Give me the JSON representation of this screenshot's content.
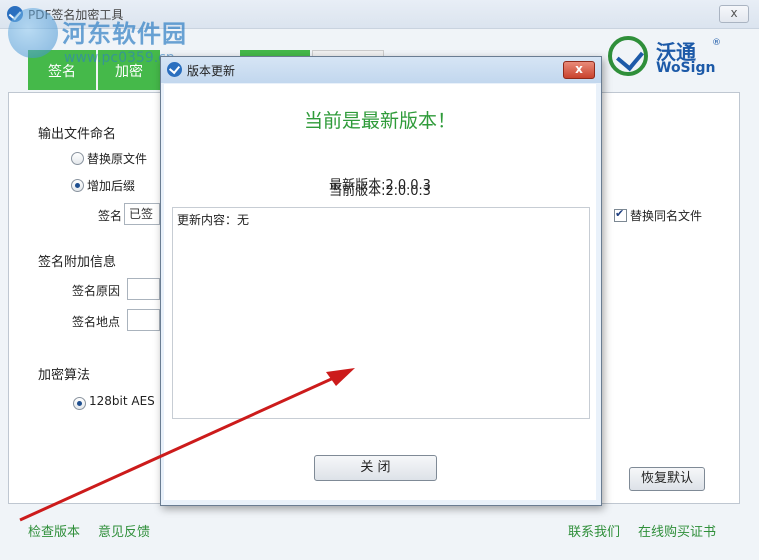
{
  "main": {
    "title": "PDF签名加密工具",
    "close_glyph": "x",
    "watermark": {
      "site": "河东软件园",
      "url": "www.pc0359.cn"
    },
    "tabs": [
      "签名",
      "加密",
      "",
      ""
    ],
    "brand": {
      "cn": "沃通",
      "en": "WoSign",
      "reg": "®"
    },
    "output_naming": {
      "heading": "输出文件命名",
      "option_replace": "替换原文件",
      "option_suffix": "增加后缀",
      "selected": "增加后缀",
      "name_label": "签名",
      "name_value": "已签名"
    },
    "replace_same_name": {
      "label": "替换同名文件",
      "checked": true
    },
    "sign_info": {
      "heading": "签名附加信息",
      "reason_label": "签名原因",
      "reason_value": "",
      "location_label": "签名地点",
      "location_value": ""
    },
    "encryption": {
      "heading": "加密算法",
      "option": "128bit AES",
      "selected": true
    },
    "restore_defaults": "恢复默认",
    "footer_links": {
      "check_version": "检查版本",
      "feedback": "意见反馈",
      "contact": "联系我们",
      "buy_cert": "在线购买证书"
    }
  },
  "dialog": {
    "title": "版本更新",
    "close_glyph": "x",
    "headline": "当前是最新版本！",
    "latest_version": "最新版本:2.0.0.3",
    "current_version": "当前版本:2.0.0.3",
    "notes": "更新内容：无",
    "close_button": "关 闭"
  }
}
